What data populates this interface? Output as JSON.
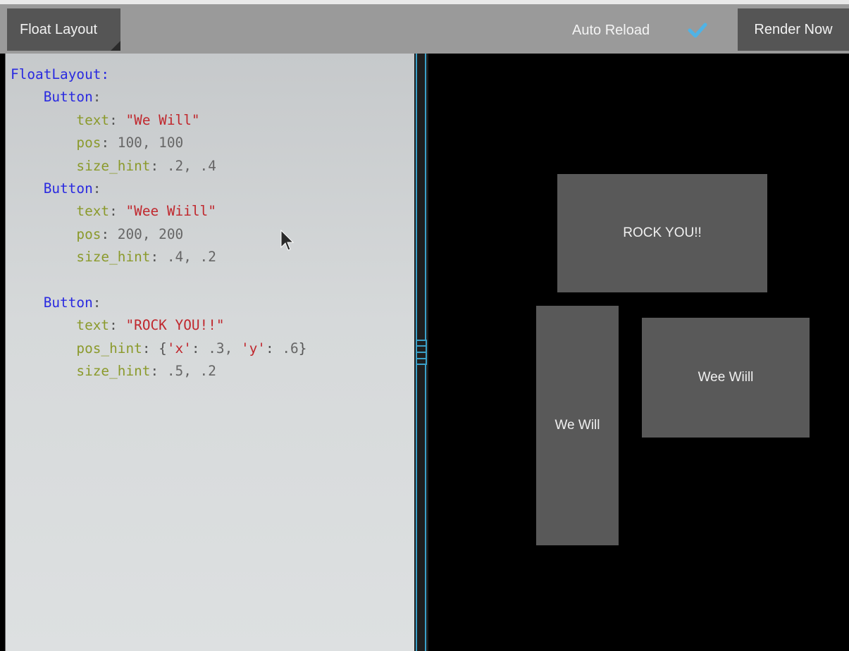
{
  "toolbar": {
    "layout_selector": "Float Layout",
    "auto_reload_label": "Auto Reload",
    "auto_reload_checked": true,
    "render_button": "Render Now"
  },
  "editor": {
    "lines": [
      {
        "indent": "",
        "tokens": [
          {
            "t": "FloatLayout",
            "c": "class"
          },
          {
            "t": ":",
            "c": "class"
          }
        ]
      },
      {
        "indent": "    ",
        "tokens": [
          {
            "t": "Button",
            "c": "class"
          },
          {
            "t": ":",
            "c": "punct"
          }
        ]
      },
      {
        "indent": "        ",
        "tokens": [
          {
            "t": "text",
            "c": "key"
          },
          {
            "t": ": ",
            "c": "punct"
          },
          {
            "t": "\"We Will\"",
            "c": "str"
          }
        ]
      },
      {
        "indent": "        ",
        "tokens": [
          {
            "t": "pos",
            "c": "key"
          },
          {
            "t": ": ",
            "c": "punct"
          },
          {
            "t": "100, 100",
            "c": "num"
          }
        ]
      },
      {
        "indent": "        ",
        "tokens": [
          {
            "t": "size_hint",
            "c": "key"
          },
          {
            "t": ": ",
            "c": "punct"
          },
          {
            "t": ".2, .4",
            "c": "num"
          }
        ]
      },
      {
        "indent": "    ",
        "tokens": [
          {
            "t": "Button",
            "c": "class"
          },
          {
            "t": ":",
            "c": "punct"
          }
        ]
      },
      {
        "indent": "        ",
        "tokens": [
          {
            "t": "text",
            "c": "key"
          },
          {
            "t": ": ",
            "c": "punct"
          },
          {
            "t": "\"Wee Wiill\"",
            "c": "str"
          }
        ]
      },
      {
        "indent": "        ",
        "tokens": [
          {
            "t": "pos",
            "c": "key"
          },
          {
            "t": ": ",
            "c": "punct"
          },
          {
            "t": "200, 200",
            "c": "num"
          }
        ]
      },
      {
        "indent": "        ",
        "tokens": [
          {
            "t": "size_hint",
            "c": "key"
          },
          {
            "t": ": ",
            "c": "punct"
          },
          {
            "t": ".4, .2",
            "c": "num"
          }
        ]
      },
      {
        "indent": "",
        "tokens": []
      },
      {
        "indent": "    ",
        "tokens": [
          {
            "t": "Button",
            "c": "class"
          },
          {
            "t": ":",
            "c": "punct"
          }
        ]
      },
      {
        "indent": "        ",
        "tokens": [
          {
            "t": "text",
            "c": "key"
          },
          {
            "t": ": ",
            "c": "punct"
          },
          {
            "t": "\"ROCK YOU!!\"",
            "c": "str"
          }
        ]
      },
      {
        "indent": "        ",
        "tokens": [
          {
            "t": "pos_hint",
            "c": "key"
          },
          {
            "t": ": ",
            "c": "punct"
          },
          {
            "t": "{",
            "c": "punct"
          },
          {
            "t": "'x'",
            "c": "str"
          },
          {
            "t": ": ",
            "c": "punct"
          },
          {
            "t": ".3, ",
            "c": "num"
          },
          {
            "t": "'y'",
            "c": "str"
          },
          {
            "t": ": ",
            "c": "punct"
          },
          {
            "t": ".6",
            "c": "num"
          },
          {
            "t": "}",
            "c": "punct"
          }
        ]
      },
      {
        "indent": "        ",
        "tokens": [
          {
            "t": "size_hint",
            "c": "key"
          },
          {
            "t": ": ",
            "c": "punct"
          },
          {
            "t": ".5, .2",
            "c": "num"
          }
        ]
      }
    ]
  },
  "preview": {
    "buttons": {
      "rock": "ROCK YOU!!",
      "we_will": "We Will",
      "wee_wiill": "Wee Wiill"
    }
  },
  "colors": {
    "toolbar_bg": "#9a9a9a",
    "button_bg": "#555555",
    "accent": "#3aa0c8",
    "keyword": "#2a2ae0",
    "property": "#8b9a2c",
    "string": "#c0272d"
  },
  "icons": {
    "checkbox": "checkmark-icon",
    "pointer": "mouse-pointer-icon",
    "grip": "splitter-grip-icon"
  }
}
